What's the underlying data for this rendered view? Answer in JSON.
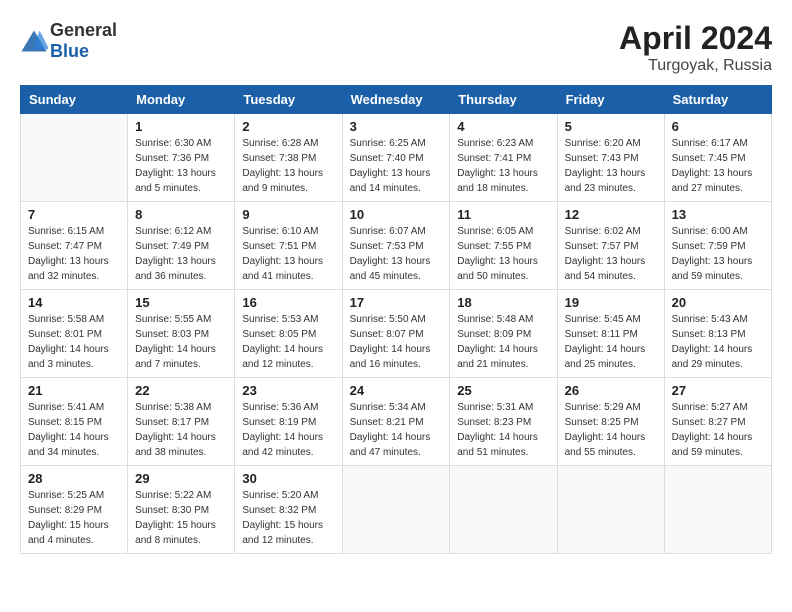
{
  "header": {
    "logo_general": "General",
    "logo_blue": "Blue",
    "month_year": "April 2024",
    "location": "Turgoyak, Russia"
  },
  "days_of_week": [
    "Sunday",
    "Monday",
    "Tuesday",
    "Wednesday",
    "Thursday",
    "Friday",
    "Saturday"
  ],
  "weeks": [
    [
      {
        "day": "",
        "sunrise": "",
        "sunset": "",
        "daylight": ""
      },
      {
        "day": "1",
        "sunrise": "Sunrise: 6:30 AM",
        "sunset": "Sunset: 7:36 PM",
        "daylight": "Daylight: 13 hours and 5 minutes."
      },
      {
        "day": "2",
        "sunrise": "Sunrise: 6:28 AM",
        "sunset": "Sunset: 7:38 PM",
        "daylight": "Daylight: 13 hours and 9 minutes."
      },
      {
        "day": "3",
        "sunrise": "Sunrise: 6:25 AM",
        "sunset": "Sunset: 7:40 PM",
        "daylight": "Daylight: 13 hours and 14 minutes."
      },
      {
        "day": "4",
        "sunrise": "Sunrise: 6:23 AM",
        "sunset": "Sunset: 7:41 PM",
        "daylight": "Daylight: 13 hours and 18 minutes."
      },
      {
        "day": "5",
        "sunrise": "Sunrise: 6:20 AM",
        "sunset": "Sunset: 7:43 PM",
        "daylight": "Daylight: 13 hours and 23 minutes."
      },
      {
        "day": "6",
        "sunrise": "Sunrise: 6:17 AM",
        "sunset": "Sunset: 7:45 PM",
        "daylight": "Daylight: 13 hours and 27 minutes."
      }
    ],
    [
      {
        "day": "7",
        "sunrise": "Sunrise: 6:15 AM",
        "sunset": "Sunset: 7:47 PM",
        "daylight": "Daylight: 13 hours and 32 minutes."
      },
      {
        "day": "8",
        "sunrise": "Sunrise: 6:12 AM",
        "sunset": "Sunset: 7:49 PM",
        "daylight": "Daylight: 13 hours and 36 minutes."
      },
      {
        "day": "9",
        "sunrise": "Sunrise: 6:10 AM",
        "sunset": "Sunset: 7:51 PM",
        "daylight": "Daylight: 13 hours and 41 minutes."
      },
      {
        "day": "10",
        "sunrise": "Sunrise: 6:07 AM",
        "sunset": "Sunset: 7:53 PM",
        "daylight": "Daylight: 13 hours and 45 minutes."
      },
      {
        "day": "11",
        "sunrise": "Sunrise: 6:05 AM",
        "sunset": "Sunset: 7:55 PM",
        "daylight": "Daylight: 13 hours and 50 minutes."
      },
      {
        "day": "12",
        "sunrise": "Sunrise: 6:02 AM",
        "sunset": "Sunset: 7:57 PM",
        "daylight": "Daylight: 13 hours and 54 minutes."
      },
      {
        "day": "13",
        "sunrise": "Sunrise: 6:00 AM",
        "sunset": "Sunset: 7:59 PM",
        "daylight": "Daylight: 13 hours and 59 minutes."
      }
    ],
    [
      {
        "day": "14",
        "sunrise": "Sunrise: 5:58 AM",
        "sunset": "Sunset: 8:01 PM",
        "daylight": "Daylight: 14 hours and 3 minutes."
      },
      {
        "day": "15",
        "sunrise": "Sunrise: 5:55 AM",
        "sunset": "Sunset: 8:03 PM",
        "daylight": "Daylight: 14 hours and 7 minutes."
      },
      {
        "day": "16",
        "sunrise": "Sunrise: 5:53 AM",
        "sunset": "Sunset: 8:05 PM",
        "daylight": "Daylight: 14 hours and 12 minutes."
      },
      {
        "day": "17",
        "sunrise": "Sunrise: 5:50 AM",
        "sunset": "Sunset: 8:07 PM",
        "daylight": "Daylight: 14 hours and 16 minutes."
      },
      {
        "day": "18",
        "sunrise": "Sunrise: 5:48 AM",
        "sunset": "Sunset: 8:09 PM",
        "daylight": "Daylight: 14 hours and 21 minutes."
      },
      {
        "day": "19",
        "sunrise": "Sunrise: 5:45 AM",
        "sunset": "Sunset: 8:11 PM",
        "daylight": "Daylight: 14 hours and 25 minutes."
      },
      {
        "day": "20",
        "sunrise": "Sunrise: 5:43 AM",
        "sunset": "Sunset: 8:13 PM",
        "daylight": "Daylight: 14 hours and 29 minutes."
      }
    ],
    [
      {
        "day": "21",
        "sunrise": "Sunrise: 5:41 AM",
        "sunset": "Sunset: 8:15 PM",
        "daylight": "Daylight: 14 hours and 34 minutes."
      },
      {
        "day": "22",
        "sunrise": "Sunrise: 5:38 AM",
        "sunset": "Sunset: 8:17 PM",
        "daylight": "Daylight: 14 hours and 38 minutes."
      },
      {
        "day": "23",
        "sunrise": "Sunrise: 5:36 AM",
        "sunset": "Sunset: 8:19 PM",
        "daylight": "Daylight: 14 hours and 42 minutes."
      },
      {
        "day": "24",
        "sunrise": "Sunrise: 5:34 AM",
        "sunset": "Sunset: 8:21 PM",
        "daylight": "Daylight: 14 hours and 47 minutes."
      },
      {
        "day": "25",
        "sunrise": "Sunrise: 5:31 AM",
        "sunset": "Sunset: 8:23 PM",
        "daylight": "Daylight: 14 hours and 51 minutes."
      },
      {
        "day": "26",
        "sunrise": "Sunrise: 5:29 AM",
        "sunset": "Sunset: 8:25 PM",
        "daylight": "Daylight: 14 hours and 55 minutes."
      },
      {
        "day": "27",
        "sunrise": "Sunrise: 5:27 AM",
        "sunset": "Sunset: 8:27 PM",
        "daylight": "Daylight: 14 hours and 59 minutes."
      }
    ],
    [
      {
        "day": "28",
        "sunrise": "Sunrise: 5:25 AM",
        "sunset": "Sunset: 8:29 PM",
        "daylight": "Daylight: 15 hours and 4 minutes."
      },
      {
        "day": "29",
        "sunrise": "Sunrise: 5:22 AM",
        "sunset": "Sunset: 8:30 PM",
        "daylight": "Daylight: 15 hours and 8 minutes."
      },
      {
        "day": "30",
        "sunrise": "Sunrise: 5:20 AM",
        "sunset": "Sunset: 8:32 PM",
        "daylight": "Daylight: 15 hours and 12 minutes."
      },
      {
        "day": "",
        "sunrise": "",
        "sunset": "",
        "daylight": ""
      },
      {
        "day": "",
        "sunrise": "",
        "sunset": "",
        "daylight": ""
      },
      {
        "day": "",
        "sunrise": "",
        "sunset": "",
        "daylight": ""
      },
      {
        "day": "",
        "sunrise": "",
        "sunset": "",
        "daylight": ""
      }
    ]
  ]
}
